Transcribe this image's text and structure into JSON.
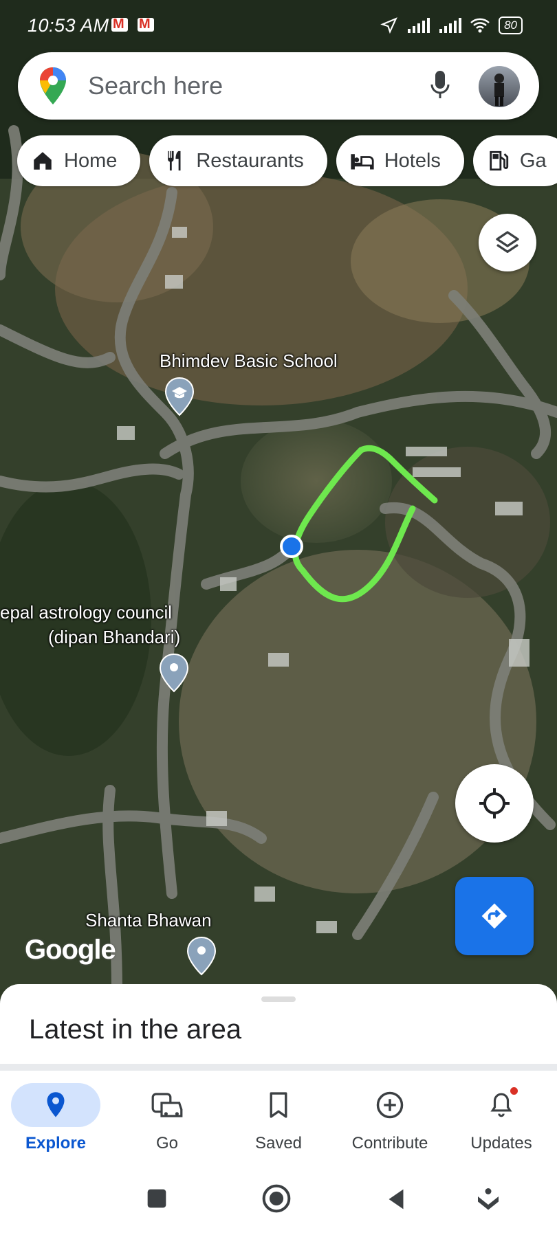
{
  "status_bar": {
    "time": "10:53 AM",
    "battery": "80"
  },
  "search": {
    "placeholder": "Search here"
  },
  "chips": [
    {
      "label": "Home",
      "icon": "home-icon"
    },
    {
      "label": "Restaurants",
      "icon": "restaurant-icon"
    },
    {
      "label": "Hotels",
      "icon": "hotel-icon"
    },
    {
      "label": "Ga",
      "icon": "gas-station-icon"
    }
  ],
  "map": {
    "places": [
      {
        "name": "Bhimdev Basic School",
        "icon": "school-pin-icon"
      },
      {
        "name": "epal astrology council",
        "name2": "(dipan Bhandari)",
        "icon": "place-pin-icon"
      },
      {
        "name": "Shanta Bhawan",
        "icon": "place-pin-icon"
      }
    ],
    "attribution": "Google"
  },
  "sheet": {
    "title": "Latest in the area"
  },
  "nav": [
    {
      "label": "Explore",
      "icon": "explore-pin-icon",
      "active": true
    },
    {
      "label": "Go",
      "icon": "commute-icon"
    },
    {
      "label": "Saved",
      "icon": "bookmark-icon"
    },
    {
      "label": "Contribute",
      "icon": "add-circle-icon"
    },
    {
      "label": "Updates",
      "icon": "bell-icon"
    }
  ],
  "colors": {
    "accent": "#1a73e8",
    "drawing": "#6ee84e",
    "nav_active_bg": "#d3e3fd"
  }
}
